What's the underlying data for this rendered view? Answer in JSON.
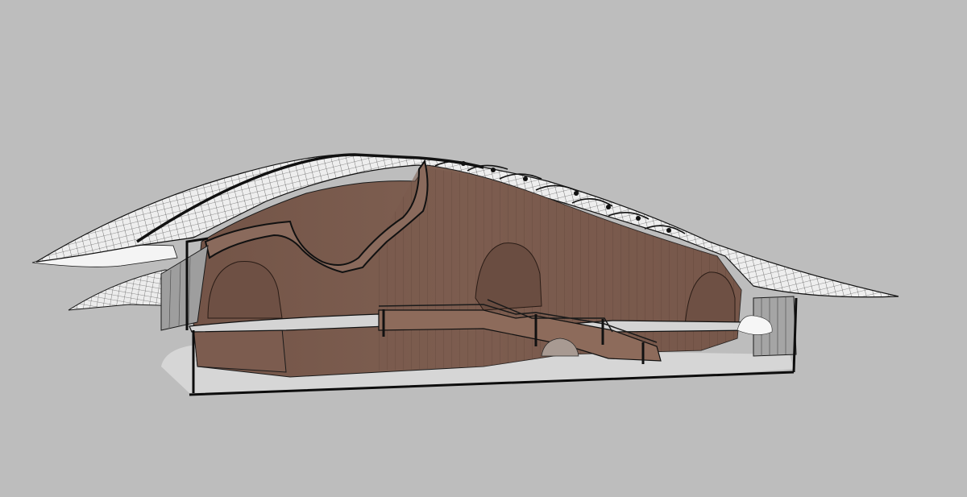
{
  "viewport": {
    "background_color": "#bdbdbd"
  },
  "model": {
    "wood_color": "#7a5a4d",
    "wood_shadow_color": "#6a4d41",
    "wood_light_color": "#8a6a5c",
    "roof_color": "#e9e9e9",
    "floor_color": "#d8d8d8",
    "line_color": "#1a1a1a",
    "glass_color": "#9a9a9a"
  }
}
